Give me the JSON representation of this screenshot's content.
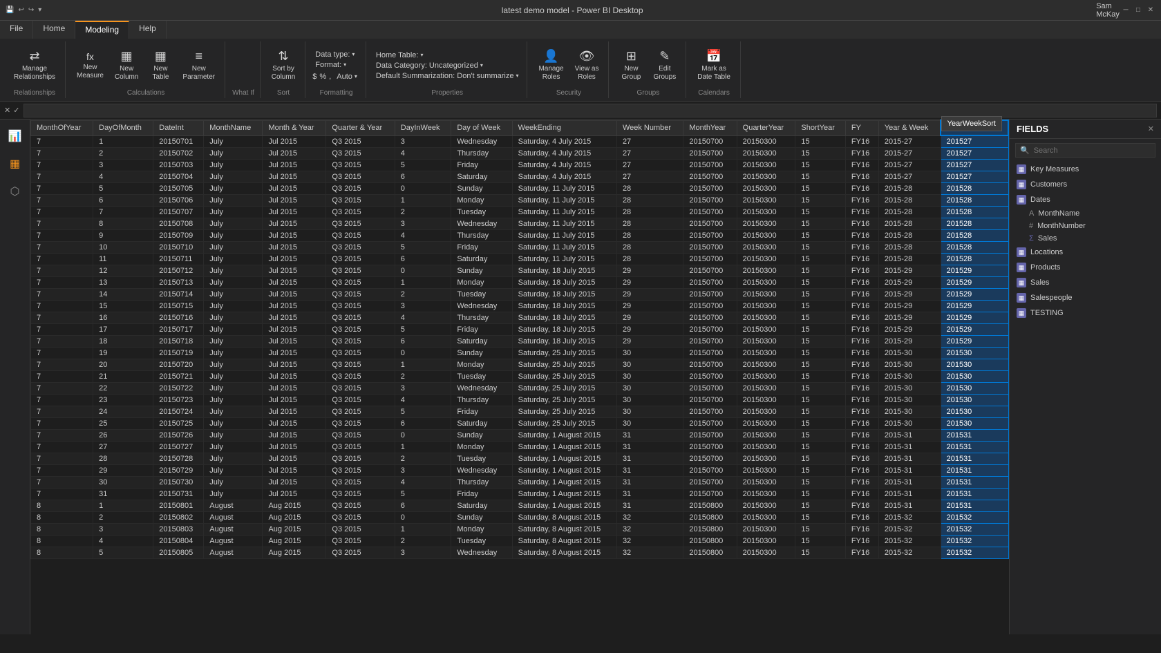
{
  "titlebar": {
    "title": "latest demo model - Power BI Desktop",
    "user": "Sam McKay",
    "minimize": "─",
    "maximize": "□",
    "close": "✕"
  },
  "ribbon": {
    "tabs": [
      "File",
      "Home",
      "Modeling",
      "Help"
    ],
    "active_tab": "Modeling",
    "groups": {
      "relationships": {
        "label": "Relationships",
        "buttons": [
          {
            "id": "manage-relationships",
            "label": "Manage\nRelationships",
            "icon": "⇄"
          },
          {
            "id": "new-measure",
            "label": "New\nMeasure",
            "icon": "fx"
          },
          {
            "id": "new-column",
            "label": "New\nColumn",
            "icon": "▦"
          },
          {
            "id": "new-table",
            "label": "New\nTable",
            "icon": "▦"
          },
          {
            "id": "new-parameter",
            "label": "New\nParameter",
            "icon": "≡"
          }
        ]
      },
      "calculations": {
        "label": "Calculations"
      },
      "what_if": {
        "label": "What If"
      },
      "sort": {
        "label": "Sort",
        "buttons": [
          {
            "id": "sort-by-column",
            "label": "Sort by\nColumn",
            "icon": "⇅"
          }
        ]
      },
      "formatting": {
        "label": "Formatting",
        "items": [
          {
            "label": "Data type:",
            "value": ""
          },
          {
            "label": "Format:",
            "value": ""
          },
          {
            "label": "$ % ,",
            "value": "Auto"
          }
        ]
      },
      "properties": {
        "label": "Properties",
        "items": [
          {
            "label": "Home Table:",
            "value": ""
          },
          {
            "label": "Data Category:",
            "value": "Uncategorized"
          },
          {
            "label": "Default Summarization:",
            "value": "Don't summarize"
          }
        ]
      },
      "security": {
        "label": "Security",
        "buttons": [
          {
            "id": "manage-roles",
            "label": "Manage\nRoles",
            "icon": "👤"
          },
          {
            "id": "view-as-roles",
            "label": "View as\nRoles",
            "icon": "👁"
          }
        ]
      },
      "groups_section": {
        "label": "Groups",
        "buttons": [
          {
            "id": "new-group",
            "label": "New\nGroup",
            "icon": "⊞"
          },
          {
            "id": "edit-groups",
            "label": "Edit\nGroups",
            "icon": "✎"
          }
        ]
      },
      "calendars": {
        "label": "Calendars",
        "buttons": [
          {
            "id": "mark-date-table",
            "label": "Mark as\nDate Table",
            "icon": "📅"
          }
        ]
      }
    }
  },
  "formula_bar": {
    "cancel": "✕",
    "confirm": "✓",
    "value": ""
  },
  "table": {
    "columns": [
      "MonthOfYear",
      "DayOfMonth",
      "DateInt",
      "MonthName",
      "Month & Year",
      "Quarter & Year",
      "DayInWeek",
      "Day of Week",
      "WeekEnding",
      "Week Number",
      "MonthYear",
      "QuarterYear",
      "ShortYear",
      "FY",
      "Year & Week",
      "YearWeekSort"
    ],
    "active_column": "YearWeekSort",
    "rows": [
      [
        7,
        1,
        "20150701",
        "July",
        "Jul 2015",
        "Q3 2015",
        3,
        "Wednesday",
        "Saturday, 4 July 2015",
        27,
        "20150700",
        "20150300",
        15,
        "FY16",
        "2015-27",
        "201527"
      ],
      [
        7,
        2,
        "20150702",
        "July",
        "Jul 2015",
        "Q3 2015",
        4,
        "Thursday",
        "Saturday, 4 July 2015",
        27,
        "20150700",
        "20150300",
        15,
        "FY16",
        "2015-27",
        "201527"
      ],
      [
        7,
        3,
        "20150703",
        "July",
        "Jul 2015",
        "Q3 2015",
        5,
        "Friday",
        "Saturday, 4 July 2015",
        27,
        "20150700",
        "20150300",
        15,
        "FY16",
        "2015-27",
        "201527"
      ],
      [
        7,
        4,
        "20150704",
        "July",
        "Jul 2015",
        "Q3 2015",
        6,
        "Saturday",
        "Saturday, 4 July 2015",
        27,
        "20150700",
        "20150300",
        15,
        "FY16",
        "2015-27",
        "201527"
      ],
      [
        7,
        5,
        "20150705",
        "July",
        "Jul 2015",
        "Q3 2015",
        0,
        "Sunday",
        "Saturday, 11 July 2015",
        28,
        "20150700",
        "20150300",
        15,
        "FY16",
        "2015-28",
        "201528"
      ],
      [
        7,
        6,
        "20150706",
        "July",
        "Jul 2015",
        "Q3 2015",
        1,
        "Monday",
        "Saturday, 11 July 2015",
        28,
        "20150700",
        "20150300",
        15,
        "FY16",
        "2015-28",
        "201528"
      ],
      [
        7,
        7,
        "20150707",
        "July",
        "Jul 2015",
        "Q3 2015",
        2,
        "Tuesday",
        "Saturday, 11 July 2015",
        28,
        "20150700",
        "20150300",
        15,
        "FY16",
        "2015-28",
        "201528"
      ],
      [
        7,
        8,
        "20150708",
        "July",
        "Jul 2015",
        "Q3 2015",
        3,
        "Wednesday",
        "Saturday, 11 July 2015",
        28,
        "20150700",
        "20150300",
        15,
        "FY16",
        "2015-28",
        "201528"
      ],
      [
        7,
        9,
        "20150709",
        "July",
        "Jul 2015",
        "Q3 2015",
        4,
        "Thursday",
        "Saturday, 11 July 2015",
        28,
        "20150700",
        "20150300",
        15,
        "FY16",
        "2015-28",
        "201528"
      ],
      [
        7,
        10,
        "20150710",
        "July",
        "Jul 2015",
        "Q3 2015",
        5,
        "Friday",
        "Saturday, 11 July 2015",
        28,
        "20150700",
        "20150300",
        15,
        "FY16",
        "2015-28",
        "201528"
      ],
      [
        7,
        11,
        "20150711",
        "July",
        "Jul 2015",
        "Q3 2015",
        6,
        "Saturday",
        "Saturday, 11 July 2015",
        28,
        "20150700",
        "20150300",
        15,
        "FY16",
        "2015-28",
        "201528"
      ],
      [
        7,
        12,
        "20150712",
        "July",
        "Jul 2015",
        "Q3 2015",
        0,
        "Sunday",
        "Saturday, 18 July 2015",
        29,
        "20150700",
        "20150300",
        15,
        "FY16",
        "2015-29",
        "201529"
      ],
      [
        7,
        13,
        "20150713",
        "July",
        "Jul 2015",
        "Q3 2015",
        1,
        "Monday",
        "Saturday, 18 July 2015",
        29,
        "20150700",
        "20150300",
        15,
        "FY16",
        "2015-29",
        "201529"
      ],
      [
        7,
        14,
        "20150714",
        "July",
        "Jul 2015",
        "Q3 2015",
        2,
        "Tuesday",
        "Saturday, 18 July 2015",
        29,
        "20150700",
        "20150300",
        15,
        "FY16",
        "2015-29",
        "201529"
      ],
      [
        7,
        15,
        "20150715",
        "July",
        "Jul 2015",
        "Q3 2015",
        3,
        "Wednesday",
        "Saturday, 18 July 2015",
        29,
        "20150700",
        "20150300",
        15,
        "FY16",
        "2015-29",
        "201529"
      ],
      [
        7,
        16,
        "20150716",
        "July",
        "Jul 2015",
        "Q3 2015",
        4,
        "Thursday",
        "Saturday, 18 July 2015",
        29,
        "20150700",
        "20150300",
        15,
        "FY16",
        "2015-29",
        "201529"
      ],
      [
        7,
        17,
        "20150717",
        "July",
        "Jul 2015",
        "Q3 2015",
        5,
        "Friday",
        "Saturday, 18 July 2015",
        29,
        "20150700",
        "20150300",
        15,
        "FY16",
        "2015-29",
        "201529"
      ],
      [
        7,
        18,
        "20150718",
        "July",
        "Jul 2015",
        "Q3 2015",
        6,
        "Saturday",
        "Saturday, 18 July 2015",
        29,
        "20150700",
        "20150300",
        15,
        "FY16",
        "2015-29",
        "201529"
      ],
      [
        7,
        19,
        "20150719",
        "July",
        "Jul 2015",
        "Q3 2015",
        0,
        "Sunday",
        "Saturday, 25 July 2015",
        30,
        "20150700",
        "20150300",
        15,
        "FY16",
        "2015-30",
        "201530"
      ],
      [
        7,
        20,
        "20150720",
        "July",
        "Jul 2015",
        "Q3 2015",
        1,
        "Monday",
        "Saturday, 25 July 2015",
        30,
        "20150700",
        "20150300",
        15,
        "FY16",
        "2015-30",
        "201530"
      ],
      [
        7,
        21,
        "20150721",
        "July",
        "Jul 2015",
        "Q3 2015",
        2,
        "Tuesday",
        "Saturday, 25 July 2015",
        30,
        "20150700",
        "20150300",
        15,
        "FY16",
        "2015-30",
        "201530"
      ],
      [
        7,
        22,
        "20150722",
        "July",
        "Jul 2015",
        "Q3 2015",
        3,
        "Wednesday",
        "Saturday, 25 July 2015",
        30,
        "20150700",
        "20150300",
        15,
        "FY16",
        "2015-30",
        "201530"
      ],
      [
        7,
        23,
        "20150723",
        "July",
        "Jul 2015",
        "Q3 2015",
        4,
        "Thursday",
        "Saturday, 25 July 2015",
        30,
        "20150700",
        "20150300",
        15,
        "FY16",
        "2015-30",
        "201530"
      ],
      [
        7,
        24,
        "20150724",
        "July",
        "Jul 2015",
        "Q3 2015",
        5,
        "Friday",
        "Saturday, 25 July 2015",
        30,
        "20150700",
        "20150300",
        15,
        "FY16",
        "2015-30",
        "201530"
      ],
      [
        7,
        25,
        "20150725",
        "July",
        "Jul 2015",
        "Q3 2015",
        6,
        "Saturday",
        "Saturday, 25 July 2015",
        30,
        "20150700",
        "20150300",
        15,
        "FY16",
        "2015-30",
        "201530"
      ],
      [
        7,
        26,
        "20150726",
        "July",
        "Jul 2015",
        "Q3 2015",
        0,
        "Sunday",
        "Saturday, 1 August 2015",
        31,
        "20150700",
        "20150300",
        15,
        "FY16",
        "2015-31",
        "201531"
      ],
      [
        7,
        27,
        "20150727",
        "July",
        "Jul 2015",
        "Q3 2015",
        1,
        "Monday",
        "Saturday, 1 August 2015",
        31,
        "20150700",
        "20150300",
        15,
        "FY16",
        "2015-31",
        "201531"
      ],
      [
        7,
        28,
        "20150728",
        "July",
        "Jul 2015",
        "Q3 2015",
        2,
        "Tuesday",
        "Saturday, 1 August 2015",
        31,
        "20150700",
        "20150300",
        15,
        "FY16",
        "2015-31",
        "201531"
      ],
      [
        7,
        29,
        "20150729",
        "July",
        "Jul 2015",
        "Q3 2015",
        3,
        "Wednesday",
        "Saturday, 1 August 2015",
        31,
        "20150700",
        "20150300",
        15,
        "FY16",
        "2015-31",
        "201531"
      ],
      [
        7,
        30,
        "20150730",
        "July",
        "Jul 2015",
        "Q3 2015",
        4,
        "Thursday",
        "Saturday, 1 August 2015",
        31,
        "20150700",
        "20150300",
        15,
        "FY16",
        "2015-31",
        "201531"
      ],
      [
        7,
        31,
        "20150731",
        "July",
        "Jul 2015",
        "Q3 2015",
        5,
        "Friday",
        "Saturday, 1 August 2015",
        31,
        "20150700",
        "20150300",
        15,
        "FY16",
        "2015-31",
        "201531"
      ],
      [
        8,
        1,
        "20150801",
        "August",
        "Aug 2015",
        "Q3 2015",
        6,
        "Saturday",
        "Saturday, 1 August 2015",
        31,
        "20150800",
        "20150300",
        15,
        "FY16",
        "2015-31",
        "201531"
      ],
      [
        8,
        2,
        "20150802",
        "August",
        "Aug 2015",
        "Q3 2015",
        0,
        "Sunday",
        "Saturday, 8 August 2015",
        32,
        "20150800",
        "20150300",
        15,
        "FY16",
        "2015-32",
        "201532"
      ],
      [
        8,
        3,
        "20150803",
        "August",
        "Aug 2015",
        "Q3 2015",
        1,
        "Monday",
        "Saturday, 8 August 2015",
        32,
        "20150800",
        "20150300",
        15,
        "FY16",
        "2015-32",
        "201532"
      ],
      [
        8,
        4,
        "20150804",
        "August",
        "Aug 2015",
        "Q3 2015",
        2,
        "Tuesday",
        "Saturday, 8 August 2015",
        32,
        "20150800",
        "20150300",
        15,
        "FY16",
        "2015-32",
        "201532"
      ],
      [
        8,
        5,
        "20150805",
        "August",
        "Aug 2015",
        "Q3 2015",
        3,
        "Wednesday",
        "Saturday, 8 August 2015",
        32,
        "20150800",
        "20150300",
        15,
        "FY16",
        "2015-32",
        "201532"
      ]
    ]
  },
  "fields_panel": {
    "title": "FIELDS",
    "search_placeholder": "Search",
    "groups": [
      {
        "label": "Key Measures",
        "type": "table"
      },
      {
        "label": "Customers",
        "type": "table"
      },
      {
        "label": "Dates",
        "type": "table"
      },
      {
        "label": "Locations",
        "type": "table"
      },
      {
        "label": "Products",
        "type": "table"
      },
      {
        "label": "Sales",
        "type": "table"
      },
      {
        "label": "Salespeople",
        "type": "table"
      },
      {
        "label": "TESTING",
        "type": "table"
      }
    ],
    "expanded": {
      "label": "Dates",
      "subitems": [
        {
          "label": "MonthName",
          "type": "text"
        },
        {
          "label": "MonthNumber",
          "type": "number"
        },
        {
          "label": "Sales",
          "type": "sigma"
        }
      ]
    },
    "tooltip": "YearWeekSort"
  },
  "left_sidebar": {
    "icons": [
      {
        "id": "report-view",
        "symbol": "📊",
        "active": false
      },
      {
        "id": "data-view",
        "symbol": "▦",
        "active": true
      },
      {
        "id": "model-view",
        "symbol": "⬡",
        "active": false
      }
    ]
  }
}
